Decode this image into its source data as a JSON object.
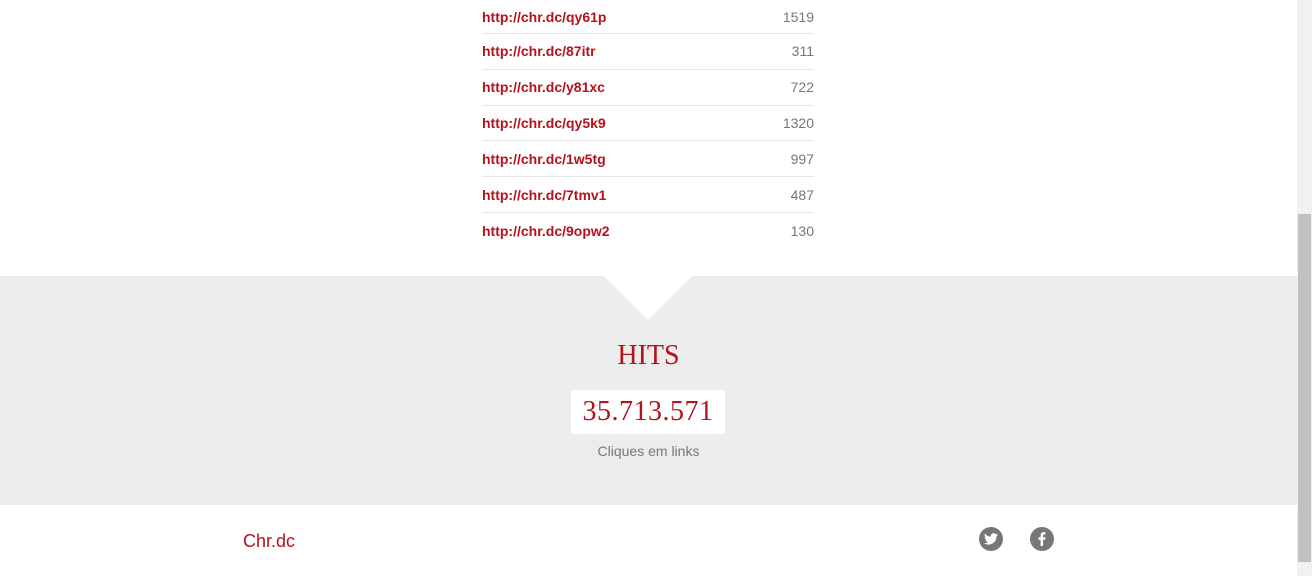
{
  "links": [
    {
      "url": "http://chr.dc/qy61p",
      "hits": "1519"
    },
    {
      "url": "http://chr.dc/87itr",
      "hits": "311"
    },
    {
      "url": "http://chr.dc/y81xc",
      "hits": "722"
    },
    {
      "url": "http://chr.dc/qy5k9",
      "hits": "1320"
    },
    {
      "url": "http://chr.dc/1w5tg",
      "hits": "997"
    },
    {
      "url": "http://chr.dc/7tmv1",
      "hits": "487"
    },
    {
      "url": "http://chr.dc/9opw2",
      "hits": "130"
    }
  ],
  "hits": {
    "title": "HITS",
    "value": "35.713.571",
    "caption": "Cliques em links"
  },
  "footer": {
    "brand": "Chr.dc",
    "social": [
      "twitter-icon",
      "facebook-icon"
    ]
  },
  "colors": {
    "accent": "#b5121b",
    "muted": "#777777",
    "band": "#ececec"
  }
}
